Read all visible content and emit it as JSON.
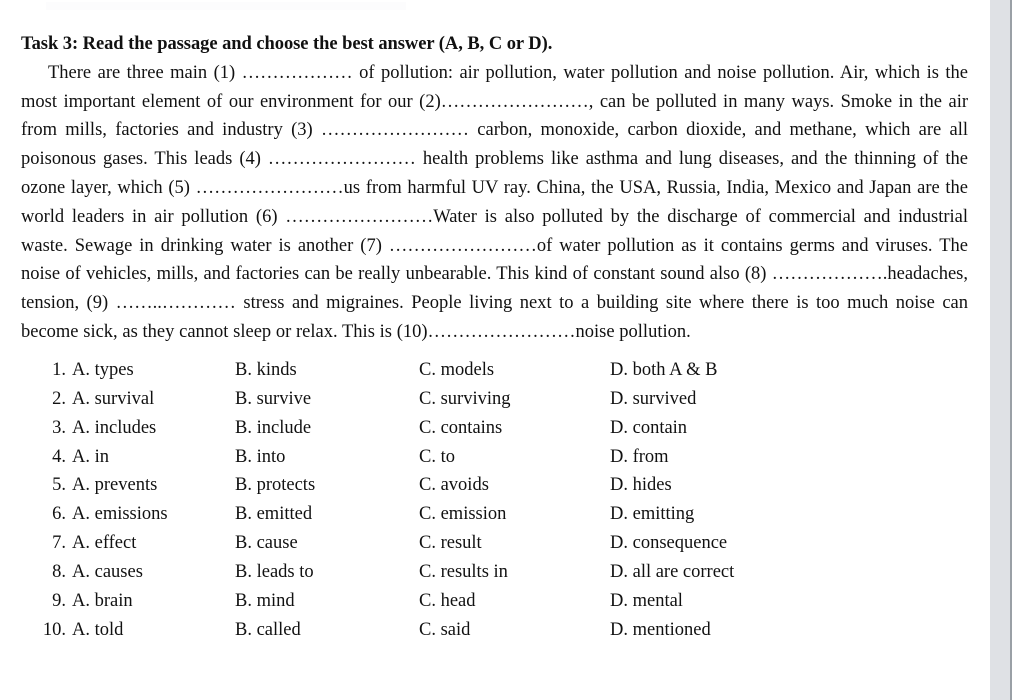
{
  "document": {
    "heading": "Task 3: Read the passage and choose the best answer (A, B, C or D).",
    "passage": "There are three main (1) ……………… of pollution: air pollution, water pollution and noise pollution. Air, which is the most important element of our environment for our (2)……………………, can be polluted in many ways. Smoke in the air from mills, factories and industry (3) …………………… carbon, monoxide, carbon dioxide, and methane, which are all poisonous gases. This leads (4) …………………… health problems like asthma and lung diseases, and the thinning of the ozone layer, which (5) ……………………us from harmful UV ray. China, the USA, Russia, India, Mexico and Japan are the world leaders in air pollution (6) ……………………Water is also polluted by the discharge of commercial and industrial waste. Sewage in drinking water is another (7) ……………………of water pollution as it contains germs and viruses. The noise of vehicles, mills, and factories can be really unbearable. This kind of constant sound also (8) ……………….headaches, tension, (9) ……..………… stress and migraines. People living next to a building site where there is too much noise can become sick, as they cannot sleep or relax. This is (10)……………………noise pollution."
  },
  "options": {
    "rows": [
      {
        "number": "1.",
        "a": "A. types",
        "b": "B. kinds",
        "c": "C. models",
        "d": "D. both A & B"
      },
      {
        "number": "2.",
        "a": "A. survival",
        "b": "B. survive",
        "c": "C. surviving",
        "d": "D. survived"
      },
      {
        "number": "3.",
        "a": "A. includes",
        "b": "B. include",
        "c": "C. contains",
        "d": "D. contain"
      },
      {
        "number": "4.",
        "a": "A. in",
        "b": "B. into",
        "c": "C. to",
        "d": "D. from"
      },
      {
        "number": "5.",
        "a": "A. prevents",
        "b": "B. protects",
        "c": "C. avoids",
        "d": "D. hides"
      },
      {
        "number": "6.",
        "a": "A. emissions",
        "b": "B. emitted",
        "c": "C. emission",
        "d": "D. emitting"
      },
      {
        "number": "7.",
        "a": "A. effect",
        "b": "B. cause",
        "c": "C. result",
        "d": "D. consequence"
      },
      {
        "number": "8.",
        "a": "A. causes",
        "b": "B. leads to",
        "c": "C. results in",
        "d": "D. all are correct"
      },
      {
        "number": "9.",
        "a": "A. brain",
        "b": "B. mind",
        "c": "C. head",
        "d": "D. mental"
      },
      {
        "number": "10.",
        "a": "A. told",
        "b": "B. called",
        "c": "C. said",
        "d": "D. mentioned"
      }
    ]
  },
  "colors": {
    "page_background": "#ffffff",
    "text": "#111111",
    "gutter": "#dfe1e5",
    "edge_line": "#9aa0a6"
  }
}
